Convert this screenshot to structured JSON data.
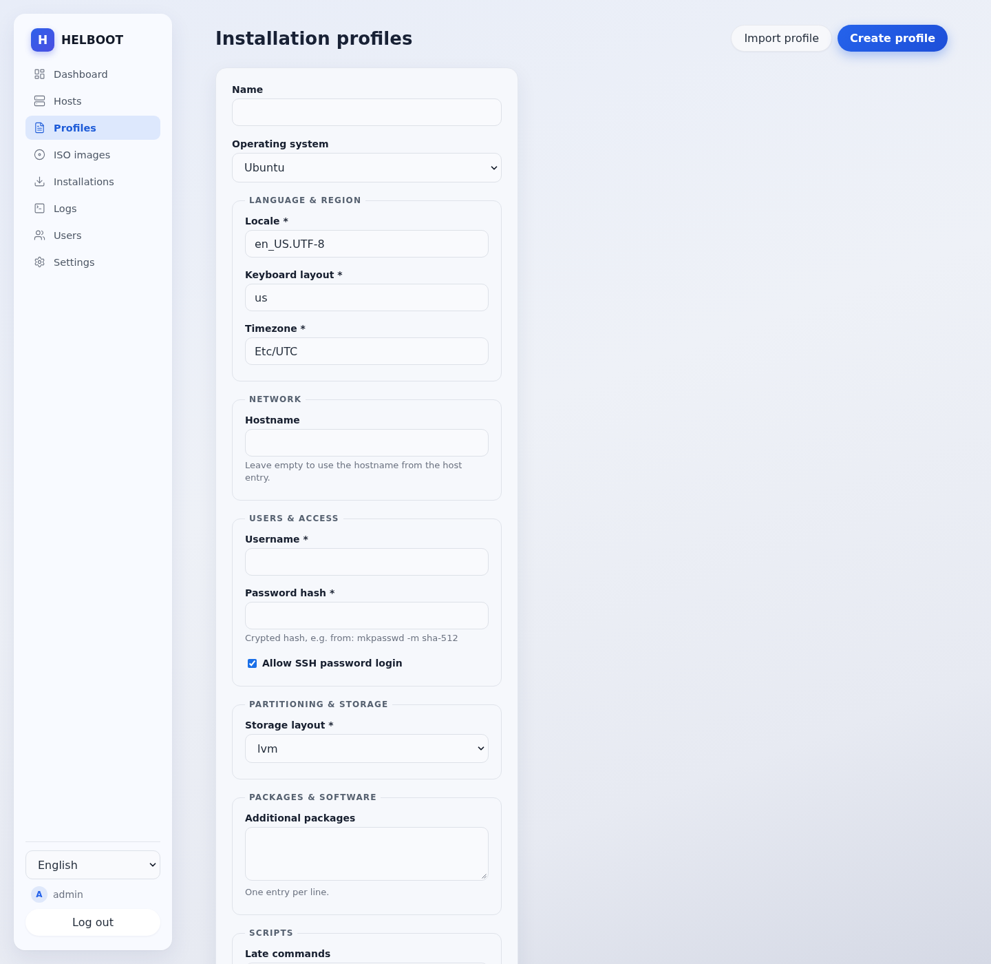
{
  "sidebar": {
    "brand": {
      "logo": "H",
      "name": "HELBOOT"
    },
    "items": [
      {
        "label": "Dashboard",
        "selected": false
      },
      {
        "label": "Hosts",
        "selected": false
      },
      {
        "label": "Profiles",
        "selected": true
      },
      {
        "label": "ISO images",
        "selected": false
      },
      {
        "label": "Installations",
        "selected": false
      },
      {
        "label": "Logs",
        "selected": false
      },
      {
        "label": "Users",
        "selected": false
      },
      {
        "label": "Settings",
        "selected": false
      }
    ],
    "language": {
      "value": "English"
    },
    "user": {
      "avatar": "A",
      "name": "admin"
    },
    "logout": "Log out"
  },
  "header": {
    "title": "Installation profiles",
    "buttons": [
      {
        "label": "Import profile",
        "kind": "secondary"
      },
      {
        "label": "Create profile",
        "kind": "primary"
      }
    ]
  },
  "form": {
    "fields": [
      {
        "kind": "input",
        "label": "Name"
      },
      {
        "kind": "select",
        "label": "Operating system",
        "value": "Ubuntu"
      }
    ],
    "sections": [
      {
        "legend": "LANGUAGE & REGION",
        "fields": [
          {
            "kind": "input",
            "label": "Locale *",
            "value": "en_US.UTF-8"
          },
          {
            "kind": "input",
            "label": "Keyboard layout *",
            "value": "us"
          },
          {
            "kind": "input",
            "label": "Timezone *",
            "value": "Etc/UTC"
          }
        ]
      },
      {
        "legend": "NETWORK",
        "fields": [
          {
            "kind": "input",
            "label": "Hostname",
            "hint": "Leave empty to use the hostname from the host entry."
          }
        ]
      },
      {
        "legend": "USERS & ACCESS",
        "fields": [
          {
            "kind": "input",
            "label": "Username *"
          },
          {
            "kind": "input",
            "label": "Password hash *",
            "hint": "Crypted hash, e.g. from: mkpasswd -m sha-512"
          },
          {
            "kind": "checkbox",
            "label": "Allow SSH password login",
            "checked": true
          }
        ]
      },
      {
        "legend": "PARTITIONING & STORAGE",
        "fields": [
          {
            "kind": "select",
            "label": "Storage layout *",
            "value": "lvm"
          }
        ]
      },
      {
        "legend": "PACKAGES & SOFTWARE",
        "fields": [
          {
            "kind": "textarea",
            "label": "Additional packages",
            "hint": "One entry per line."
          }
        ]
      },
      {
        "legend": "SCRIPTS",
        "fields": [
          {
            "kind": "textarea",
            "label": "Late commands"
          }
        ]
      }
    ]
  }
}
